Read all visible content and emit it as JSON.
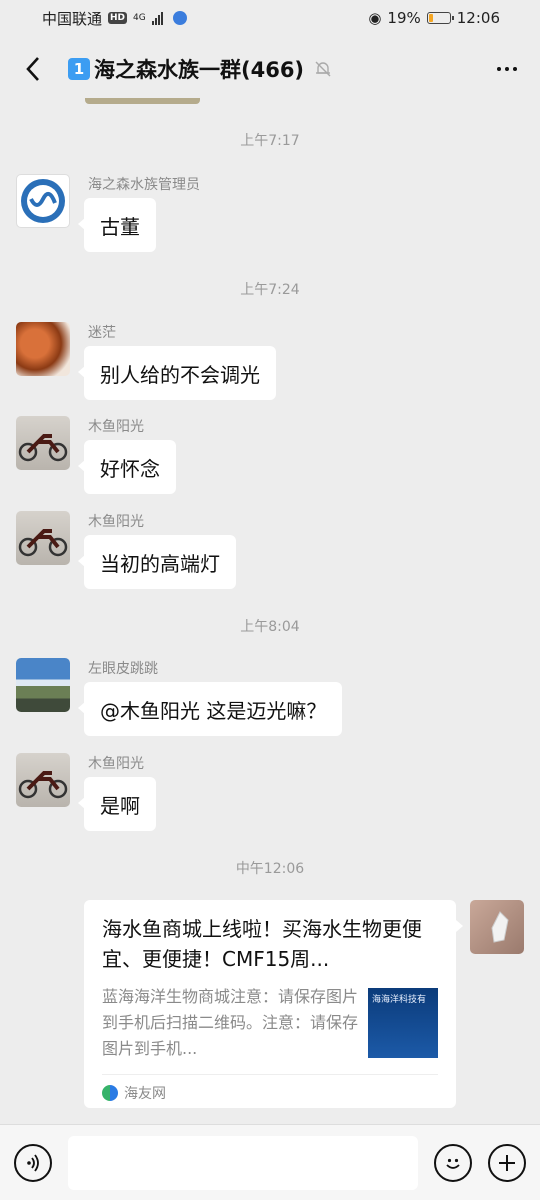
{
  "status_bar": {
    "carrier": "中国联通",
    "hd": "HD",
    "network": "4G",
    "battery": "19%",
    "battery_level": 0.19,
    "time": "12:06"
  },
  "header": {
    "badge": "1",
    "title": "海之森水族一群(466)"
  },
  "messages": [
    {
      "timestamp": "上午7:17"
    },
    {
      "sender": "海之森水族管理员",
      "text": "古董"
    },
    {
      "timestamp": "上午7:24"
    },
    {
      "sender": "迷茫",
      "text": "别人给的不会调光"
    },
    {
      "sender": "木鱼阳光",
      "text": "好怀念"
    },
    {
      "sender": "木鱼阳光",
      "text": "当初的高端灯"
    },
    {
      "timestamp": "上午8:04"
    },
    {
      "sender": "左眼皮跳跳",
      "text": "@木鱼阳光  这是迈光嘛？"
    },
    {
      "sender": "木鱼阳光",
      "text": "是啊"
    },
    {
      "timestamp": "中午12:06"
    }
  ],
  "link_card": {
    "title": "海水鱼商城上线啦！买海水生物更便宜、更便捷！CMF15周...",
    "description": "蓝海海洋生物商城注意：请保存图片到手机后扫描二维码。注意：请保存图片到手机...",
    "thumb_text": "海海洋科技有",
    "source": "海友网"
  },
  "colors": {
    "background": "#ededed",
    "bubble": "#ffffff",
    "timestamp": "#9a9a9a"
  }
}
